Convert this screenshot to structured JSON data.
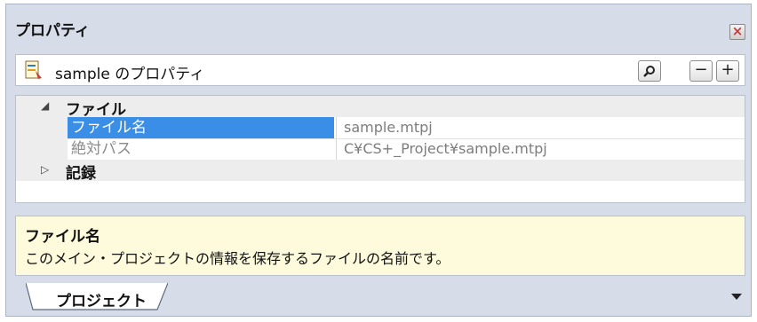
{
  "window": {
    "title": "プロパティ",
    "close_icon": "close-icon"
  },
  "toolbar": {
    "title": "sample のプロパティ",
    "search_icon": "search-icon",
    "collapse_label": "−",
    "expand_label": "+"
  },
  "grid": {
    "category_file": {
      "label": "ファイル",
      "expanded": true
    },
    "rows": [
      {
        "name": "ファイル名",
        "value": "sample.mtpj",
        "selected": true
      },
      {
        "name": "絶対パス",
        "value": "C¥CS+_Project¥sample.mtpj",
        "selected": false
      }
    ],
    "category_record": {
      "label": "記録",
      "expanded": false
    }
  },
  "description": {
    "title": "ファイル名",
    "text": "このメイン・プロジェクトの情報を保存するファイルの名前です。"
  },
  "tabs": [
    {
      "label": "プロジェクト"
    }
  ],
  "colors": {
    "selection": "#3b8ee6",
    "description_bg": "#fdfbdc",
    "panel_bg": "#d7dde8"
  }
}
